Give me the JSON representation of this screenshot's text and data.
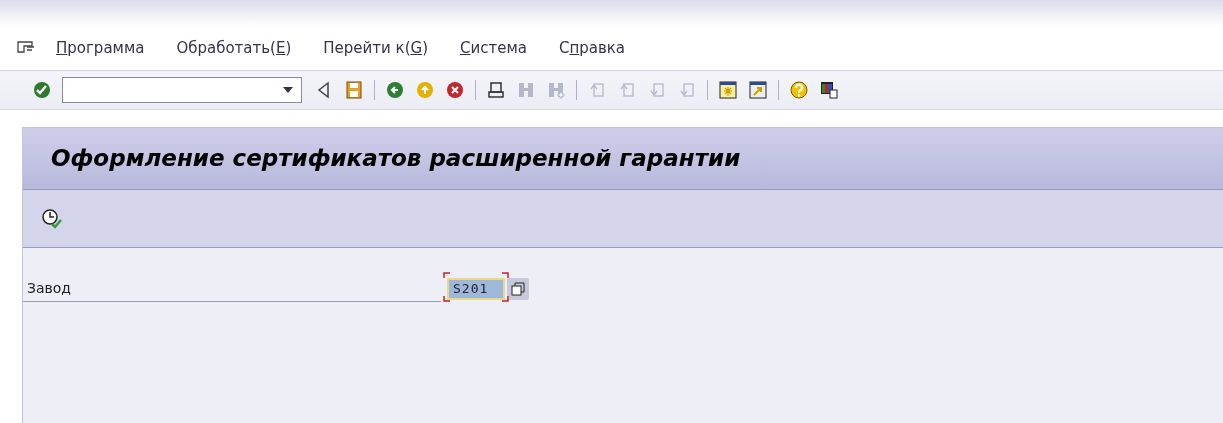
{
  "menu": [
    {
      "mnemonic": "П",
      "after": "рограмма"
    },
    {
      "before": "Обработать(",
      "mnemonic": "E",
      "after": ")"
    },
    {
      "before": "Перейти к(",
      "mnemonic": "G",
      "after": ")"
    },
    {
      "mnemonic": "С",
      "after": "истема"
    },
    {
      "before": "С",
      "mnemonic": "п",
      "after": "равка"
    }
  ],
  "toolbar": [
    {
      "kind": "enter",
      "disabled": false
    },
    {
      "kind": "command-field"
    },
    {
      "kind": "back-triangle",
      "disabled": false
    },
    {
      "kind": "save",
      "disabled": false
    },
    {
      "kind": "separator"
    },
    {
      "kind": "back",
      "disabled": false
    },
    {
      "kind": "exit",
      "disabled": false
    },
    {
      "kind": "cancel",
      "disabled": false
    },
    {
      "kind": "separator"
    },
    {
      "kind": "print",
      "disabled": false
    },
    {
      "kind": "find",
      "disabled": true
    },
    {
      "kind": "find-next",
      "disabled": true
    },
    {
      "kind": "separator"
    },
    {
      "kind": "first-page",
      "disabled": true
    },
    {
      "kind": "prev-page",
      "disabled": true
    },
    {
      "kind": "next-page",
      "disabled": true
    },
    {
      "kind": "last-page",
      "disabled": true
    },
    {
      "kind": "separator"
    },
    {
      "kind": "new-session",
      "disabled": false
    },
    {
      "kind": "shortcut",
      "disabled": false
    },
    {
      "kind": "separator"
    },
    {
      "kind": "help",
      "disabled": false
    },
    {
      "kind": "layout",
      "disabled": false
    }
  ],
  "title": "Оформление сертификатов расширенной гарантии",
  "app_toolbar": [
    {
      "kind": "execute"
    }
  ],
  "fields": [
    {
      "label": "Завод",
      "value": "S201",
      "focused": true
    }
  ]
}
